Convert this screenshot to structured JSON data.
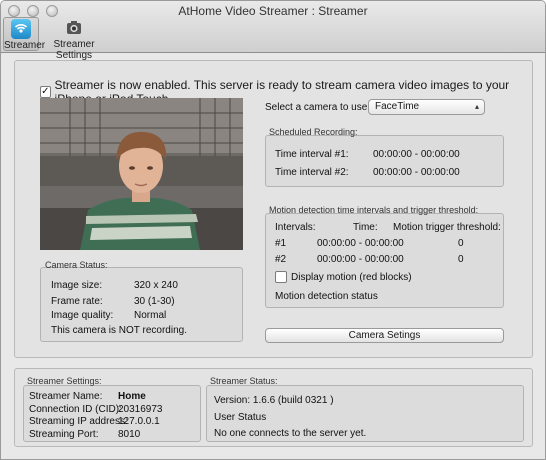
{
  "window": {
    "title": "AtHome Video Streamer : Streamer"
  },
  "toolbar": {
    "streamer_label": "Streamer",
    "settings_label": "Streamer Settings"
  },
  "main": {
    "enabled_text": "Streamer is now enabled. This server is ready to stream camera video images to your iPhone or iPod Touch.",
    "enabled_checked": true,
    "camera_select_label": "Select a camera to use:",
    "camera_select_value": "FaceTime",
    "camera_settings_button": "Camera Setings"
  },
  "scheduled": {
    "heading": "Scheduled Recording:",
    "rows": [
      {
        "label": "Time interval #1:",
        "value": "00:00:00 - 00:00:00"
      },
      {
        "label": "Time interval #2:",
        "value": "00:00:00 - 00:00:00"
      }
    ]
  },
  "motion": {
    "heading": "Motion detection time intervals and trigger threshold:",
    "col_intervals": "Intervals:",
    "col_time": "Time:",
    "col_threshold": "Motion trigger threshold:",
    "rows": [
      {
        "id": "#1",
        "time": "00:00:00 - 00:00:00",
        "threshold": "0"
      },
      {
        "id": "#2",
        "time": "00:00:00 - 00:00:00",
        "threshold": "0"
      }
    ],
    "display_motion_label": "Display motion (red blocks)",
    "display_motion_checked": false,
    "status_text": "Motion detection status"
  },
  "camera_status": {
    "heading": "Camera Status:",
    "image_size_label": "Image size:",
    "image_size_value": "320 x 240",
    "frame_rate_label": "Frame rate:",
    "frame_rate_value": "30 (1-30)",
    "image_quality_label": "Image quality:",
    "image_quality_value": "Normal",
    "recording_text": "This camera is NOT recording."
  },
  "streamer_settings": {
    "heading": "Streamer Settings:",
    "name_label": "Streamer Name:",
    "name_value": "Home",
    "cid_label": "Connection ID (CID):",
    "cid_value": "20316973",
    "ip_label": "Streaming IP address:",
    "ip_value": "127.0.0.1",
    "port_label": "Streaming Port:",
    "port_value": "8010"
  },
  "streamer_status": {
    "heading": "Streamer Status:",
    "version": "Version: 1.6.6 (build 0321 )",
    "user_status_label": "User Status",
    "user_status_value": "No one connects to the server yet."
  }
}
